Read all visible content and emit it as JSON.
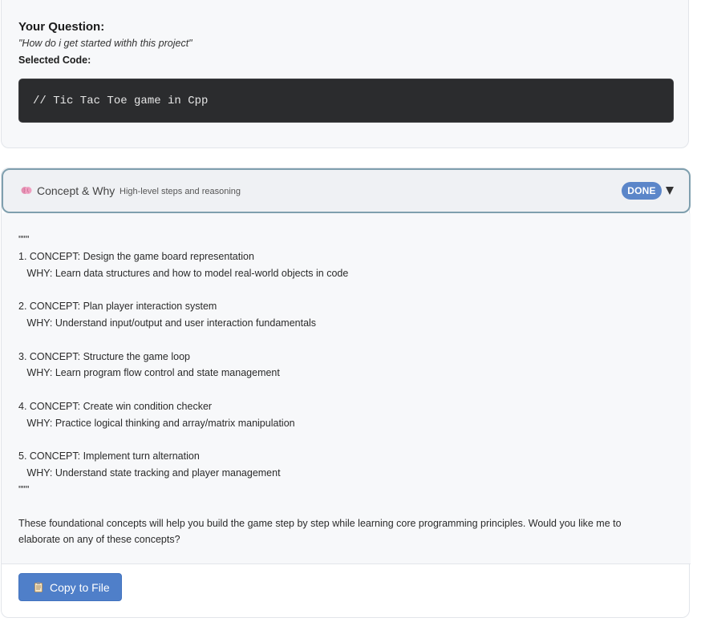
{
  "question": {
    "label": "Your Question:",
    "text": "\"How do i get started withh this project\"",
    "code_label": "Selected Code:",
    "code": "// Tic Tac Toe game in Cpp"
  },
  "section": {
    "icon": "brain-icon",
    "title": "Concept & Why",
    "subtitle": "High-level steps and reasoning",
    "status": "DONE",
    "status_color": "#5b86c9",
    "toggle_icon": "chevron-down-icon",
    "content": "\"\"\"\n1. CONCEPT: Design the game board representation\n   WHY: Learn data structures and how to model real-world objects in code\n\n2. CONCEPT: Plan player interaction system\n   WHY: Understand input/output and user interaction fundamentals\n\n3. CONCEPT: Structure the game loop\n   WHY: Learn program flow control and state management\n\n4. CONCEPT: Create win condition checker\n   WHY: Practice logical thinking and array/matrix manipulation\n\n5. CONCEPT: Implement turn alternation\n   WHY: Understand state tracking and player management\n\"\"\"\n\nThese foundational concepts will help you build the game step by step while learning core programming principles. Would you like me to elaborate on any of these concepts?"
  },
  "actions": {
    "copy_icon": "clipboard-icon",
    "copy_label": "Copy to File",
    "accent_color": "#4f7fc9"
  }
}
